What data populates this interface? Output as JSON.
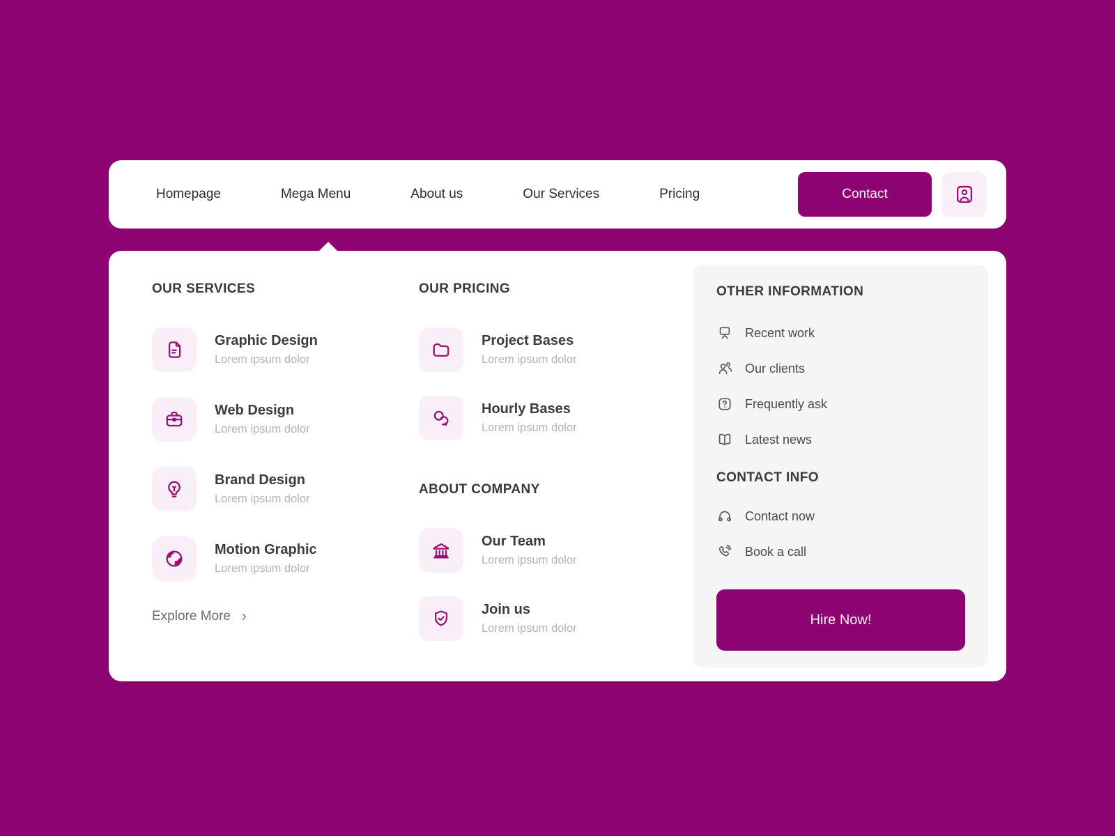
{
  "theme": {
    "page_background": "#8E0372",
    "accent_magenta": "#8E0372",
    "icon_magenta": "#9C0E74",
    "icon_tile_background": "#F9EFF8",
    "panel_background": "#FFFFFF",
    "info_panel_background": "#F6F5F6"
  },
  "navbar": {
    "links": [
      {
        "label": "Homepage"
      },
      {
        "label": "Mega Menu"
      },
      {
        "label": "About us"
      },
      {
        "label": "Our Services"
      },
      {
        "label": "Pricing"
      }
    ],
    "contact_button": "Contact",
    "account_icon": "user-card"
  },
  "menu": {
    "services": {
      "title": "OUR SERVICES",
      "items": [
        {
          "icon": "file-document",
          "title": "Graphic Design",
          "subtitle": "Lorem ipsum dolor"
        },
        {
          "icon": "briefcase",
          "title": "Web Design",
          "subtitle": "Lorem ipsum dolor"
        },
        {
          "icon": "lightbulb",
          "title": "Brand Design",
          "subtitle": "Lorem ipsum dolor"
        },
        {
          "icon": "globe",
          "title": "Motion Graphic",
          "subtitle": "Lorem ipsum dolor"
        }
      ],
      "explore_link": "Explore More"
    },
    "pricing": {
      "title": "OUR PRICING",
      "items": [
        {
          "icon": "folder",
          "title": "Project Bases",
          "subtitle": "Lorem ipsum dolor"
        },
        {
          "icon": "chat-bubbles",
          "title": "Hourly Bases",
          "subtitle": "Lorem ipsum dolor"
        }
      ]
    },
    "company": {
      "title": "ABOUT COMPANY",
      "items": [
        {
          "icon": "bank-building",
          "title": "Our Team",
          "subtitle": "Lorem ipsum dolor"
        },
        {
          "icon": "shield-check",
          "title": "Join us",
          "subtitle": "Lorem ipsum dolor"
        }
      ]
    },
    "other_info": {
      "title": "OTHER INFORMATION",
      "links": [
        {
          "icon": "workstation",
          "label": "Recent work"
        },
        {
          "icon": "users",
          "label": "Our clients"
        },
        {
          "icon": "question-box",
          "label": "Frequently ask"
        },
        {
          "icon": "open-book",
          "label": "Latest news"
        }
      ]
    },
    "contact_info": {
      "title": "CONTACT INFO",
      "links": [
        {
          "icon": "headphones",
          "label": "Contact now"
        },
        {
          "icon": "phone-ring",
          "label": "Book a call"
        }
      ]
    },
    "cta_button": "Hire Now!"
  }
}
